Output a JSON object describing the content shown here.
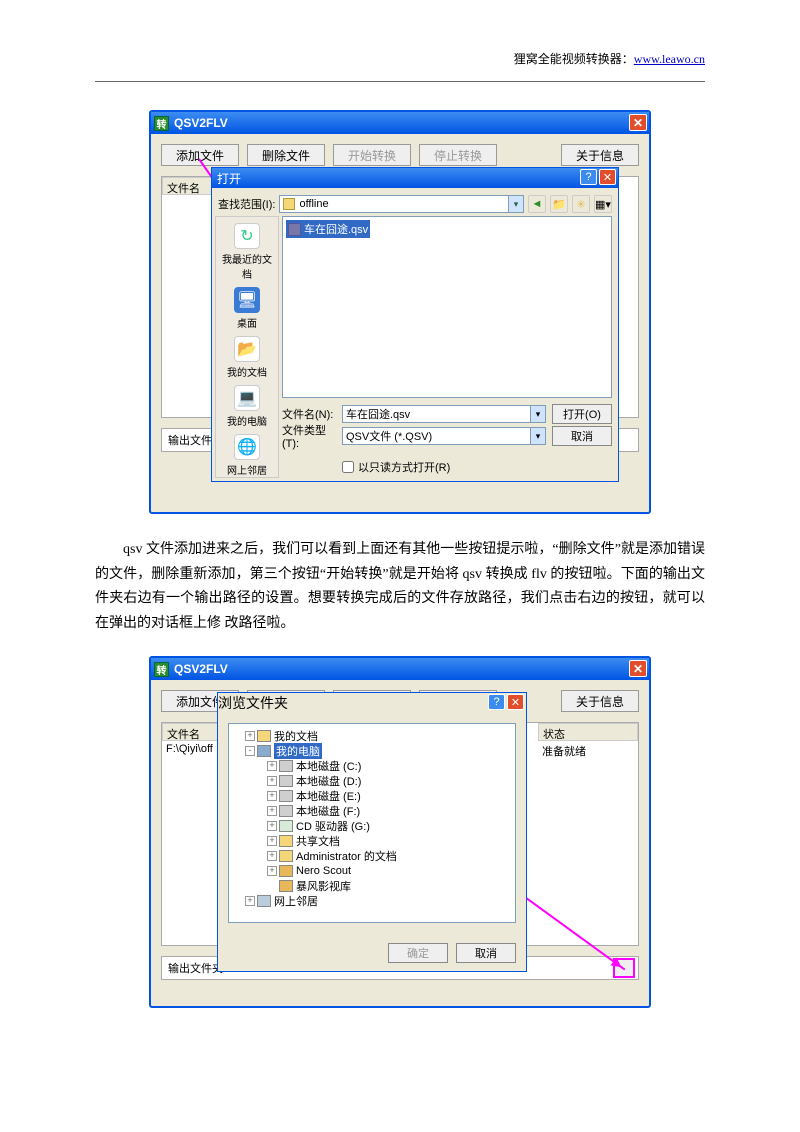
{
  "header": {
    "prefix": "狸窝全能视频转换器：",
    "link_text": "www.leawo.cn"
  },
  "app": {
    "title": "QSV2FLV",
    "buttons": {
      "add": "添加文件",
      "del": "删除文件",
      "start": "开始转换",
      "stop": "停止转换",
      "about": "关于信息"
    },
    "col_filename": "文件名",
    "col_state": "状态",
    "output_label": "输出文件夹",
    "output_label_short": "输出文件"
  },
  "open_dialog": {
    "title": "打开",
    "look_in_label": "查找范围(I):",
    "look_in_value": "offline",
    "places": {
      "recent": "我最近的文档",
      "desktop": "桌面",
      "mydocs": "我的文档",
      "mycomp": "我的电脑",
      "netplaces": "网上邻居"
    },
    "file_shown": "车在囧途.qsv",
    "filename_label": "文件名(N):",
    "filename_value": "车在囧途.qsv",
    "filetype_label": "文件类型(T):",
    "filetype_value": "QSV文件 (*.QSV)",
    "readonly": "以只读方式打开(R)",
    "open_btn": "打开(O)",
    "cancel_btn": "取消"
  },
  "paragraph": "qsv 文件添加进来之后，我们可以看到上面还有其他一些按钮提示啦，“删除文件”就是添加错误的文件，删除重新添加，第三个按钮“开始转换”就是开始将 qsv 转换成 flv 的按钮啦。下面的输出文件夹右边有一个输出路径的设置。想要转换完成后的文件存放路径，我们点击右边的按钮，就可以在弹出的对话框上修 改路径啦。",
  "row2": {
    "file": "F:\\Qiyi\\off",
    "state": "准备就绪"
  },
  "browse_dialog": {
    "title": "浏览文件夹",
    "nodes": {
      "mydocs": "我的文档",
      "mycomp": "我的电脑",
      "drive_c": "本地磁盘 (C:)",
      "drive_d": "本地磁盘 (D:)",
      "drive_e": "本地磁盘 (E:)",
      "drive_f": "本地磁盘 (F:)",
      "cd": "CD 驱动器 (G:)",
      "shared": "共享文档",
      "admin": "Administrator 的文档",
      "nero": "Nero Scout",
      "baofeng": "暴风影视库",
      "netplaces": "网上邻居"
    },
    "ok": "确定",
    "cancel": "取消"
  }
}
